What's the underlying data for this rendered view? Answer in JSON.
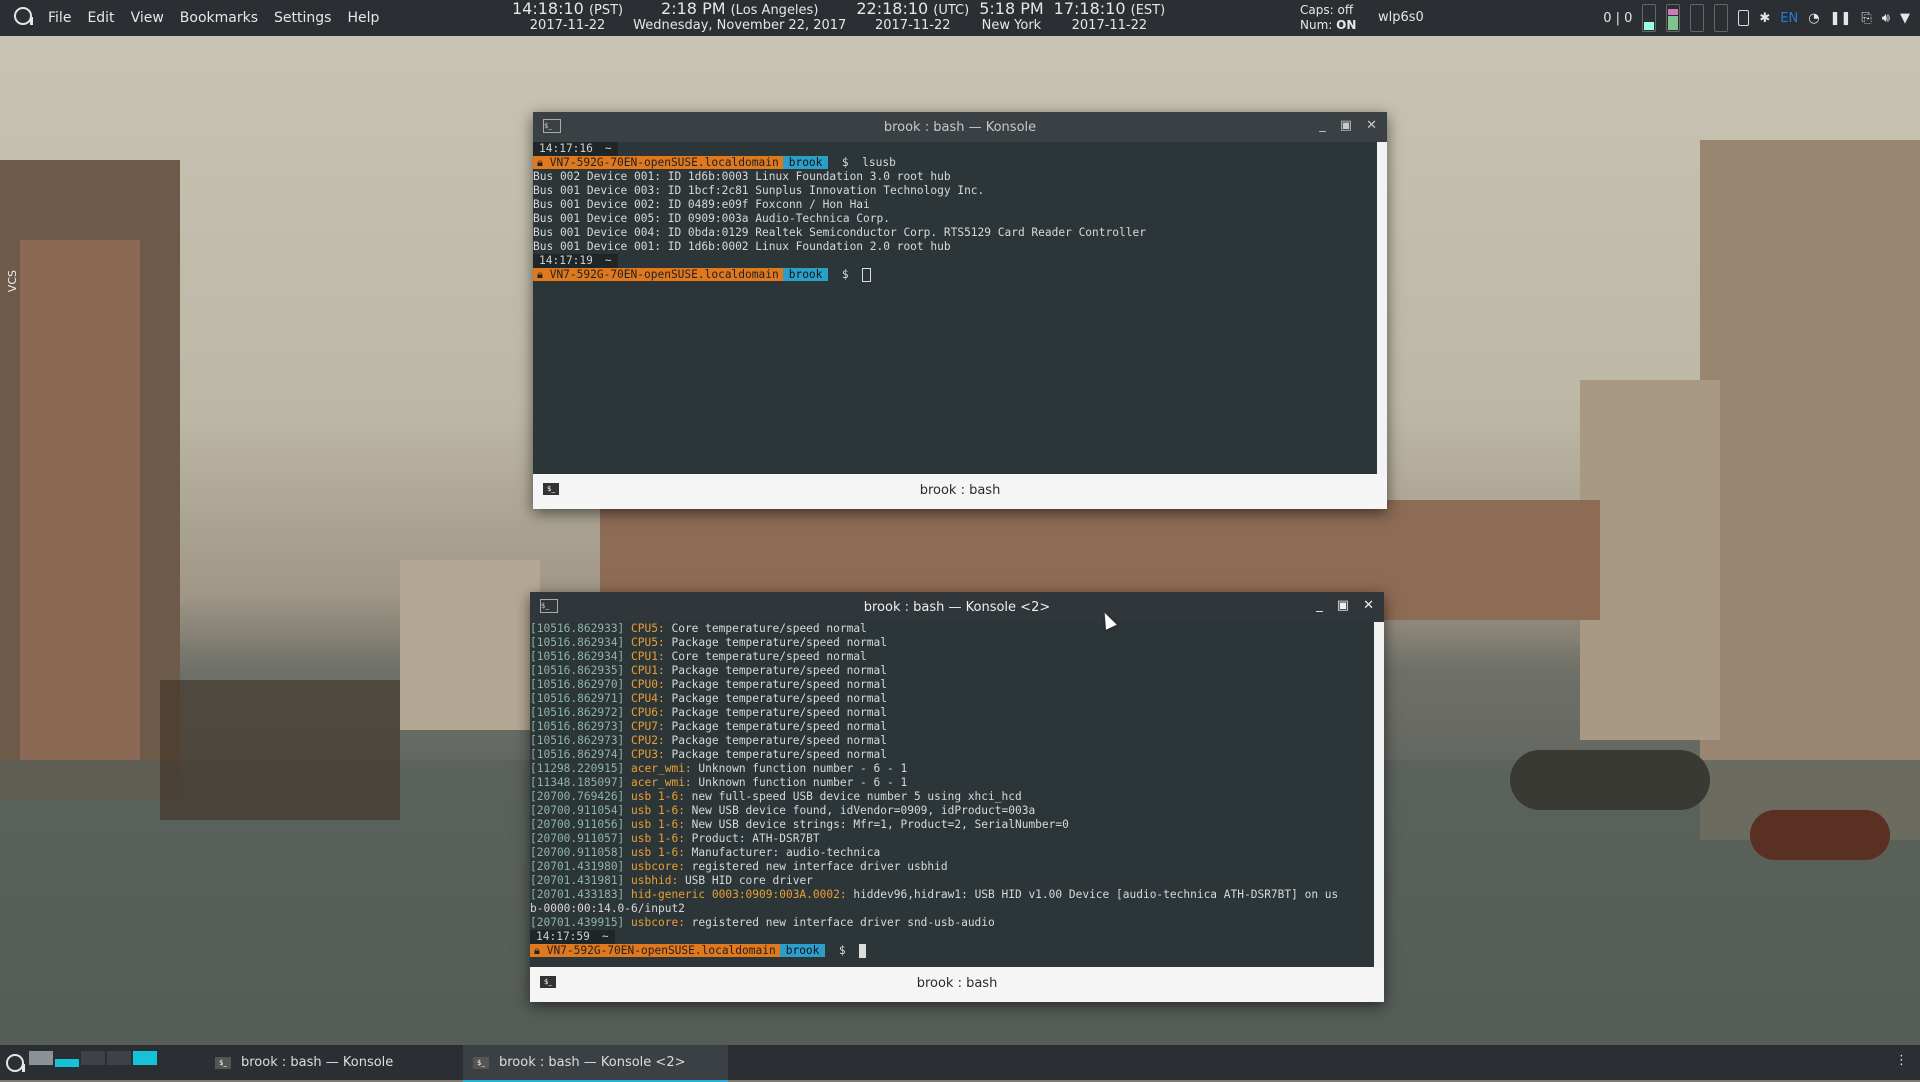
{
  "topbar": {
    "menu": [
      "File",
      "Edit",
      "View",
      "Bookmarks",
      "Settings",
      "Help"
    ],
    "clocks": [
      {
        "time": "14:18:10",
        "zone": "(PST)",
        "date": "2017-11-22"
      },
      {
        "time": "2:18 PM",
        "zone": "(Los Angeles)",
        "date": "Wednesday, November 22, 2017"
      },
      {
        "time": "22:18:10",
        "zone": "(UTC)",
        "date": "2017-11-22"
      },
      {
        "time": "5:18 PM",
        "zone": "",
        "date": "New York"
      },
      {
        "time": "17:18:10",
        "zone": "(EST)",
        "date": "2017-11-22"
      }
    ],
    "caps_label": "Caps:",
    "caps_value": "off",
    "num_label": "Num:",
    "num_value": "ON",
    "network": "wlp6s0",
    "counter": "0 | 0",
    "lang": "EN",
    "tray_icons": [
      "battery-icon",
      "bluetooth-icon",
      "wifi-icon",
      "pause-icon",
      "clip-icon",
      "volume-icon",
      "dropdown-icon"
    ]
  },
  "side_label": "VCS",
  "win1": {
    "title": "brook : bash — Konsole",
    "tab": "brook : bash",
    "prompt1": {
      "time": "14:17:16",
      "dir": "~",
      "host": "VN7-592G-70EN-openSUSE.localdomain",
      "user": "brook",
      "sym": "$",
      "cmd": "lsusb"
    },
    "output": [
      "Bus 002 Device 001: ID 1d6b:0003 Linux Foundation 3.0 root hub",
      "Bus 001 Device 003: ID 1bcf:2c81 Sunplus Innovation Technology Inc.",
      "Bus 001 Device 002: ID 0489:e09f Foxconn / Hon Hai",
      "Bus 001 Device 005: ID 0909:003a Audio-Technica Corp.",
      "Bus 001 Device 004: ID 0bda:0129 Realtek Semiconductor Corp. RTS5129 Card Reader Controller",
      "Bus 001 Device 001: ID 1d6b:0002 Linux Foundation 2.0 root hub"
    ],
    "prompt2": {
      "time": "14:17:19",
      "dir": "~",
      "host": "VN7-592G-70EN-openSUSE.localdomain",
      "user": "brook",
      "sym": "$"
    }
  },
  "win2": {
    "title": "brook : bash — Konsole <2>",
    "tab": "brook : bash",
    "log": [
      {
        "t": "[10516.862933]",
        "d": "CPU5:",
        "m": " Core temperature/speed normal"
      },
      {
        "t": "[10516.862934]",
        "d": "CPU5:",
        "m": " Package temperature/speed normal"
      },
      {
        "t": "[10516.862934]",
        "d": "CPU1:",
        "m": " Core temperature/speed normal"
      },
      {
        "t": "[10516.862935]",
        "d": "CPU1:",
        "m": " Package temperature/speed normal"
      },
      {
        "t": "[10516.862970]",
        "d": "CPU0:",
        "m": " Package temperature/speed normal"
      },
      {
        "t": "[10516.862971]",
        "d": "CPU4:",
        "m": " Package temperature/speed normal"
      },
      {
        "t": "[10516.862972]",
        "d": "CPU6:",
        "m": " Package temperature/speed normal"
      },
      {
        "t": "[10516.862973]",
        "d": "CPU7:",
        "m": " Package temperature/speed normal"
      },
      {
        "t": "[10516.862973]",
        "d": "CPU2:",
        "m": " Package temperature/speed normal"
      },
      {
        "t": "[10516.862974]",
        "d": "CPU3:",
        "m": " Package temperature/speed normal"
      },
      {
        "t": "[11298.220915]",
        "d": "acer_wmi:",
        "m": " Unknown function number - 6 - 1"
      },
      {
        "t": "[11348.185097]",
        "d": "acer_wmi:",
        "m": " Unknown function number - 6 - 1"
      },
      {
        "t": "[20700.769426]",
        "d": "usb 1-6:",
        "m": " new full-speed USB device number 5 using xhci_hcd"
      },
      {
        "t": "[20700.911054]",
        "d": "usb 1-6:",
        "m": " New USB device found, idVendor=0909, idProduct=003a"
      },
      {
        "t": "[20700.911056]",
        "d": "usb 1-6:",
        "m": " New USB device strings: Mfr=1, Product=2, SerialNumber=0"
      },
      {
        "t": "[20700.911057]",
        "d": "usb 1-6:",
        "m": " Product: ATH-DSR7BT"
      },
      {
        "t": "[20700.911058]",
        "d": "usb 1-6:",
        "m": " Manufacturer: audio-technica"
      },
      {
        "t": "[20701.431980]",
        "d": "usbcore:",
        "m": " registered new interface driver usbhid"
      },
      {
        "t": "[20701.431981]",
        "d": "usbhid:",
        "m": " USB HID core driver"
      },
      {
        "t": "[20701.433183]",
        "d": "hid-generic 0003:0909:003A.0002:",
        "m": " hiddev96,hidraw1: USB HID v1.00 Device [audio-technica ATH-DSR7BT] on us"
      },
      {
        "t": "",
        "d": "",
        "m": "b-0000:00:14.0-6/input2"
      },
      {
        "t": "[20701.439915]",
        "d": "usbcore:",
        "m": " registered new interface driver snd-usb-audio"
      }
    ],
    "prompt": {
      "time": "14:17:59",
      "dir": "~",
      "host": "VN7-592G-70EN-openSUSE.localdomain",
      "user": "brook",
      "sym": "$"
    }
  },
  "taskbar": {
    "tasks": [
      "brook : bash — Konsole",
      "brook : bash — Konsole <2>"
    ]
  }
}
